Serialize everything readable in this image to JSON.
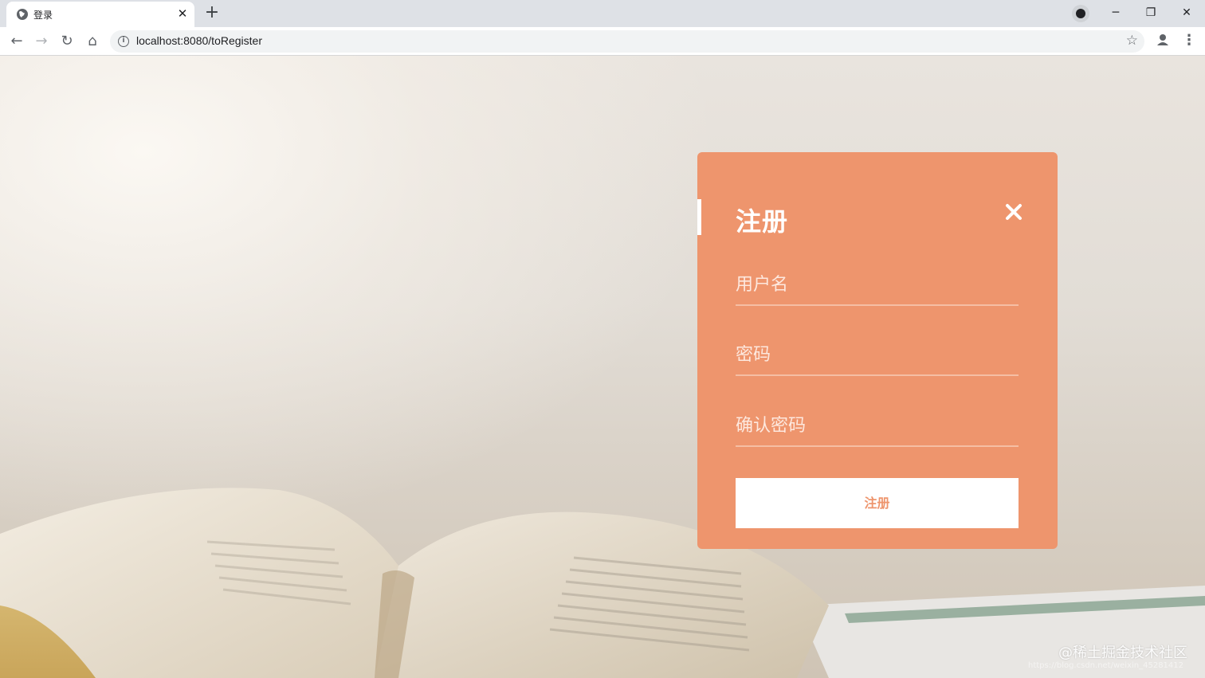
{
  "browser": {
    "tab_title": "登录",
    "tab_close_glyph": "✕",
    "new_tab_glyph": "+",
    "url": "localhost:8080/toRegister"
  },
  "window_controls": {
    "minimize": "─",
    "maximize": "❐",
    "close": "✕"
  },
  "form": {
    "title": "注册",
    "username_placeholder": "用户名",
    "password_placeholder": "密码",
    "confirm_placeholder": "确认密码",
    "submit_label": "注册"
  },
  "watermark": {
    "text": "@稀土掘金技术社区",
    "sub": "https://blog.csdn.net/weixin_45281412"
  },
  "colors": {
    "card_bg": "#ee956d",
    "accent": "#ffffff"
  }
}
